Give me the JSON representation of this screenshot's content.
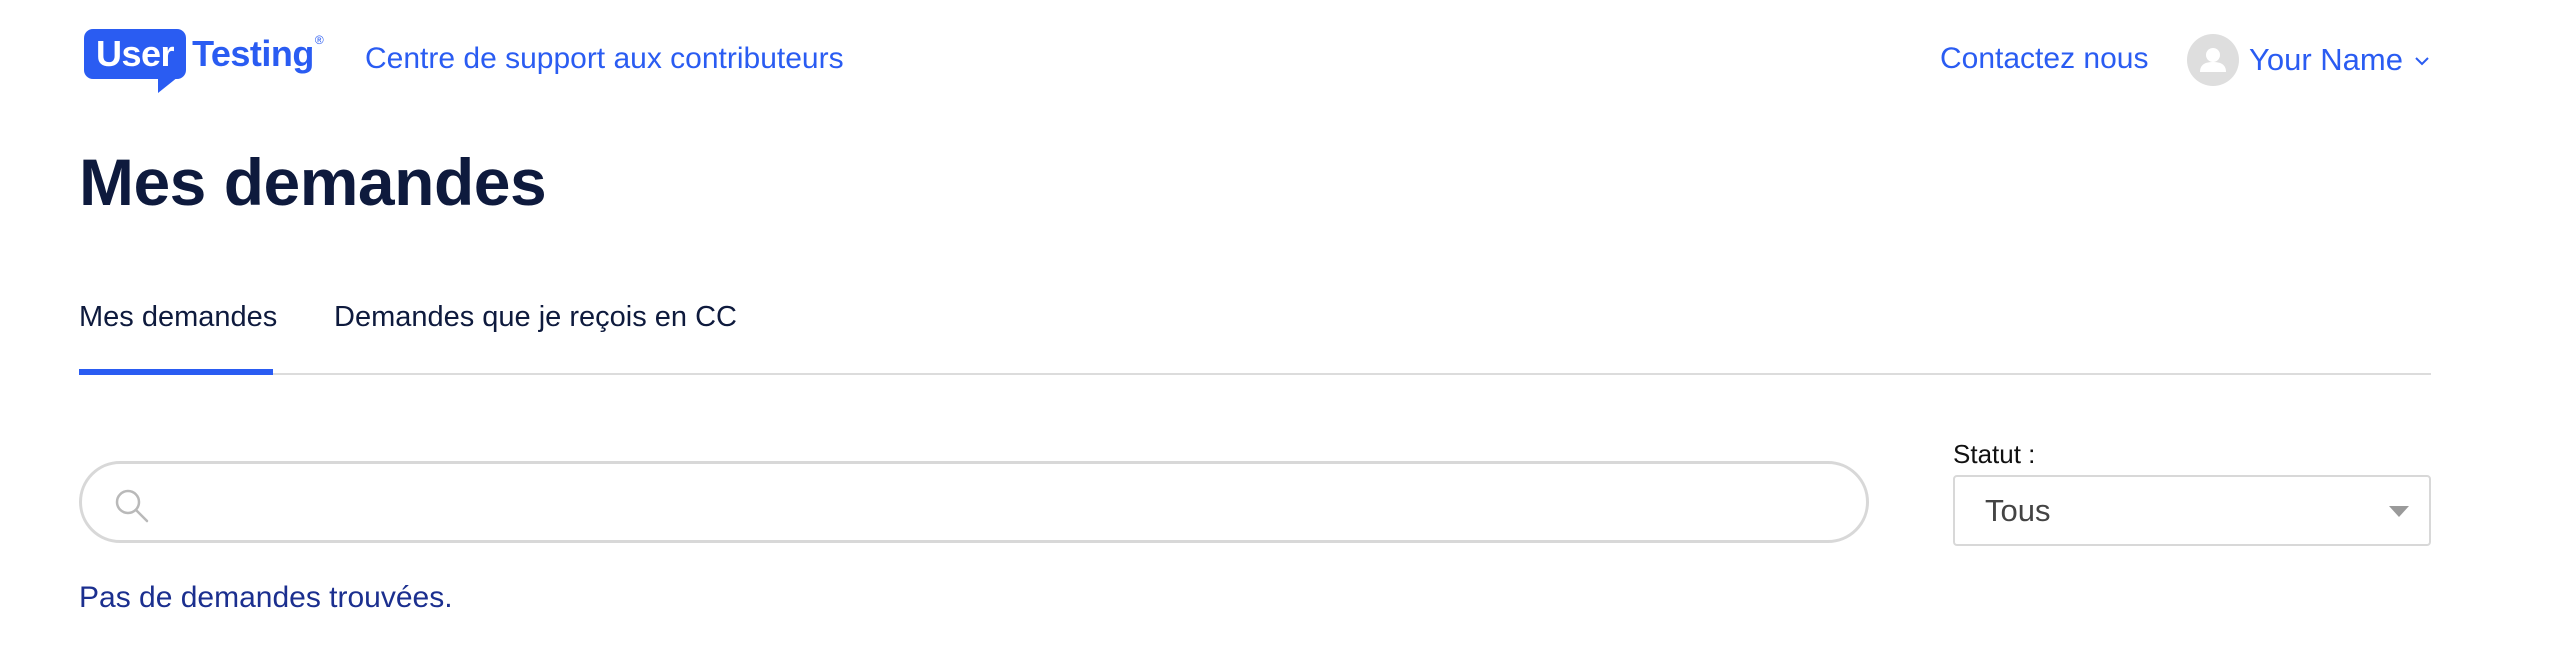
{
  "header": {
    "logo": {
      "part1": "User",
      "part2": "Testing",
      "reg": "®"
    },
    "site_title": "Centre de support aux contributeurs",
    "contact_label": "Contactez nous",
    "user": {
      "name": "Your Name",
      "avatar_icon": "user-avatar-icon",
      "menu_icon": "chevron-down-icon"
    }
  },
  "page": {
    "title": "Mes demandes"
  },
  "tabs": [
    {
      "label": "Mes demandes",
      "active": true
    },
    {
      "label": "Demandes que je reçois en CC",
      "active": false
    }
  ],
  "search": {
    "placeholder": "",
    "value": "",
    "icon": "search-icon"
  },
  "filter": {
    "label": "Statut :",
    "selected": "Tous"
  },
  "results": {
    "empty_message": "Pas de demandes trouvées."
  },
  "colors": {
    "brand": "#2a5cf2",
    "title": "#0e1a3d",
    "empty_text": "#1b2f8f"
  }
}
